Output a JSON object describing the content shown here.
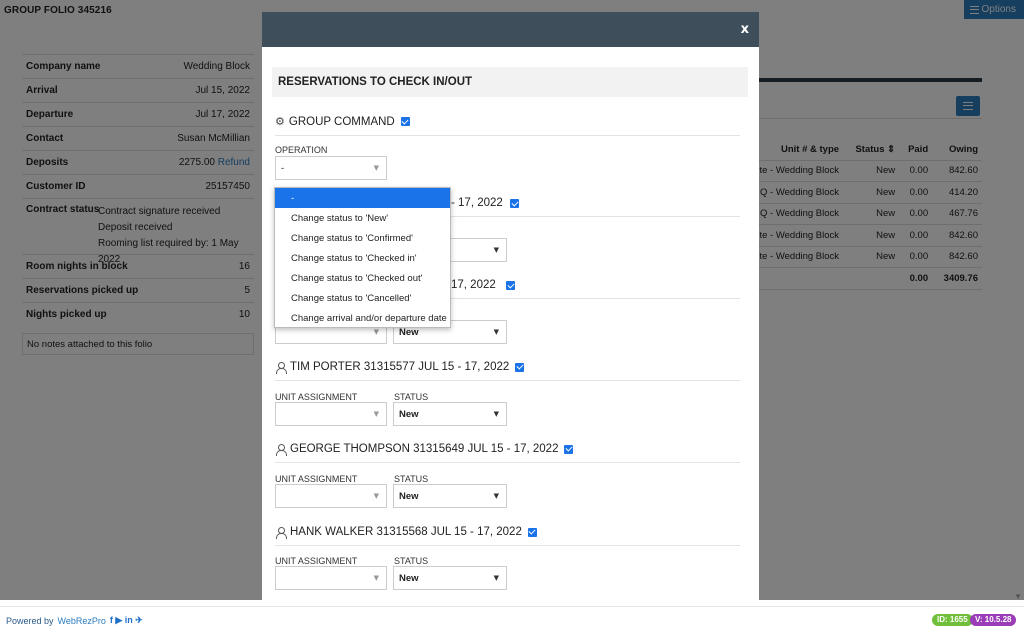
{
  "page": {
    "title": "GROUP FOLIO 345216",
    "options_label": "Options"
  },
  "info": {
    "rows": [
      {
        "key": "Company name",
        "value": "Wedding Block"
      },
      {
        "key": "Arrival",
        "value": "Jul 15, 2022"
      },
      {
        "key": "Departure",
        "value": "Jul 17, 2022"
      },
      {
        "key": "Contact",
        "value": "Susan McMillian"
      },
      {
        "key": "Deposits",
        "value": "2275.00",
        "link": "Refund"
      },
      {
        "key": "Customer ID",
        "value": "25157450"
      }
    ],
    "contract_status": {
      "key": "Contract status",
      "lines": [
        "Contract signature received",
        "Deposit received",
        "Rooming list required by: 1 May 2022"
      ]
    },
    "stats": [
      {
        "key": "Room nights in block",
        "value": "16"
      },
      {
        "key": "Reservations picked up",
        "value": "5"
      },
      {
        "key": "Nights picked up",
        "value": "10"
      }
    ],
    "notes": "No notes attached to this folio"
  },
  "reservations_table": {
    "headers": {
      "unit": "Unit # & type",
      "status": "Status ⇕",
      "paid": "Paid",
      "owing": "Owing"
    },
    "rows": [
      {
        "unit": "te - Wedding Block",
        "status": "New",
        "paid": "0.00",
        "owing": "842.60"
      },
      {
        "unit": "Q - Wedding Block",
        "status": "New",
        "paid": "0.00",
        "owing": "414.20"
      },
      {
        "unit": "Q - Wedding Block",
        "status": "New",
        "paid": "0.00",
        "owing": "467.76"
      },
      {
        "unit": "te - Wedding Block",
        "status": "New",
        "paid": "0.00",
        "owing": "842.60"
      },
      {
        "unit": "te - Wedding Block",
        "status": "New",
        "paid": "0.00",
        "owing": "842.60"
      }
    ],
    "totals": {
      "paid": "0.00",
      "owing": "3409.76"
    }
  },
  "modal": {
    "close_label": "x",
    "section_title": "RESERVATIONS TO CHECK IN/OUT",
    "group_command": "GROUP COMMAND",
    "operation_label": "OPERATION",
    "operation_value": "-",
    "operation_options": [
      "-",
      "Change status to 'New'",
      "Change status to 'Confirmed'",
      "Change status to 'Checked in'",
      "Change status to 'Checked out'",
      "Change status to 'Cancelled'",
      "Change arrival and/or departure date"
    ],
    "guests": [
      {
        "header": "- 17, 2022",
        "unit_label": "",
        "status_label": "",
        "status_value": ""
      },
      {
        "header": "17, 2022",
        "unit_label": "",
        "status_label": "",
        "status_value": "New"
      },
      {
        "header": "TIM PORTER 31315577 JUL 15 - 17, 2022",
        "unit_label": "UNIT ASSIGNMENT",
        "status_label": "STATUS",
        "status_value": "New"
      },
      {
        "header": "GEORGE THOMPSON 31315649 JUL 15 - 17, 2022",
        "unit_label": "UNIT ASSIGNMENT",
        "status_label": "STATUS",
        "status_value": "New"
      },
      {
        "header": "HANK WALKER 31315568 JUL 15 - 17, 2022",
        "unit_label": "UNIT ASSIGNMENT",
        "status_label": "STATUS",
        "status_value": "New"
      }
    ]
  },
  "footer": {
    "powered_by": "Powered by",
    "brand": "WebRezPro",
    "social": "f ▶ in ✈",
    "id_badge": "ID: 1655",
    "version_badge": "V: 10.5.28"
  }
}
